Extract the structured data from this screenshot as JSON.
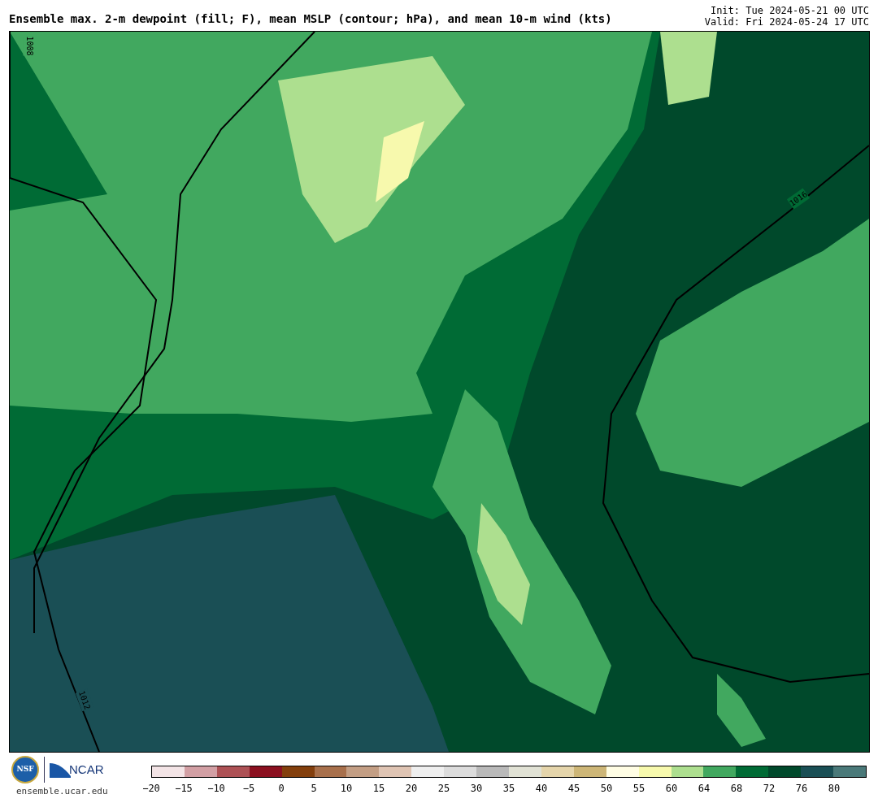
{
  "header": {
    "title": "Ensemble max. 2-m dewpoint (fill; F), mean MSLP (contour; hPa), and mean 10-m wind (kts)",
    "init": "Init: Tue 2024-05-21 00 UTC",
    "valid": "Valid: Fri 2024-05-24 17 UTC"
  },
  "map": {
    "contour_labels": [
      "1008",
      "1016",
      "1012"
    ]
  },
  "footer": {
    "nsf_logo": "NSF",
    "ncar_logo": "NCAR",
    "site": "ensemble.ucar.edu"
  },
  "colorbar": {
    "swatches": [
      {
        "color": "#f3e4e6"
      },
      {
        "color": "#d29fa4"
      },
      {
        "color": "#ad5155"
      },
      {
        "color": "#8b1020"
      },
      {
        "color": "#833f0d"
      },
      {
        "color": "#a8704c"
      },
      {
        "color": "#c39e84"
      },
      {
        "color": "#dfc4b3"
      },
      {
        "color": "#efefef"
      },
      {
        "color": "#dcdcdc"
      },
      {
        "color": "#b9b9b9"
      },
      {
        "color": "#e1e2d5"
      },
      {
        "color": "#e5d5ab"
      },
      {
        "color": "#cdb677"
      },
      {
        "color": "#fffde4"
      },
      {
        "color": "#f7f9ad"
      },
      {
        "color": "#addf8f"
      },
      {
        "color": "#41a85f"
      },
      {
        "color": "#006b35"
      },
      {
        "color": "#00492b"
      },
      {
        "color": "#1a4f55"
      },
      {
        "color": "#4a7979"
      }
    ],
    "ticks": [
      "−20",
      "−15",
      "−10",
      "−5",
      "0",
      "5",
      "10",
      "15",
      "20",
      "25",
      "30",
      "35",
      "40",
      "45",
      "50",
      "55",
      "60",
      "64",
      "68",
      "72",
      "76",
      "80"
    ]
  }
}
